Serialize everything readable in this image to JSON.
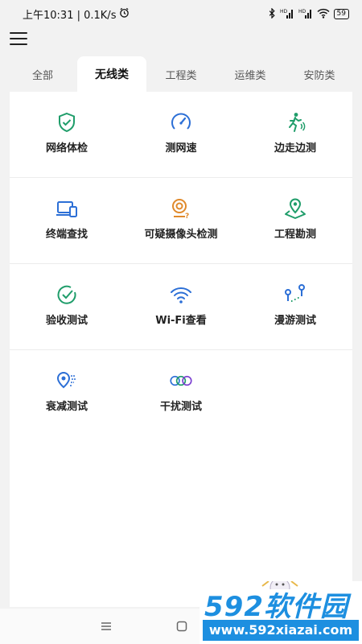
{
  "status_bar": {
    "time_speed": "上午10:31 | 0.1K/s",
    "battery": "59",
    "hd1": "HD",
    "hd2": "HD"
  },
  "tabs": [
    {
      "label": "全部",
      "active": false
    },
    {
      "label": "无线类",
      "active": true
    },
    {
      "label": "工程类",
      "active": false
    },
    {
      "label": "运维类",
      "active": false
    },
    {
      "label": "安防类",
      "active": false
    }
  ],
  "tools": [
    {
      "label": "网络体检",
      "icon": "shield-check-icon"
    },
    {
      "label": "测网速",
      "icon": "speedometer-icon"
    },
    {
      "label": "边走边测",
      "icon": "walking-person-icon"
    },
    {
      "label": "终端查找",
      "icon": "devices-icon"
    },
    {
      "label": "可疑摄像头检测",
      "icon": "camera-question-icon"
    },
    {
      "label": "工程勘测",
      "icon": "map-pin-icon"
    },
    {
      "label": "验收测试",
      "icon": "check-circle-icon"
    },
    {
      "label": "Wi-Fi查看",
      "icon": "wifi-icon"
    },
    {
      "label": "漫游测试",
      "icon": "roaming-icon"
    },
    {
      "label": "衰减测试",
      "icon": "signal-pin-icon"
    },
    {
      "label": "干扰测试",
      "icon": "rings-icon"
    }
  ],
  "colors": {
    "accent_green": "#1f9d6a",
    "accent_blue": "#2c6fd6",
    "accent_orange": "#e08a2c",
    "accent_purple": "#7b3fd0"
  },
  "watermark": {
    "title": "592软件园",
    "url": "www.592xiazai.com"
  }
}
